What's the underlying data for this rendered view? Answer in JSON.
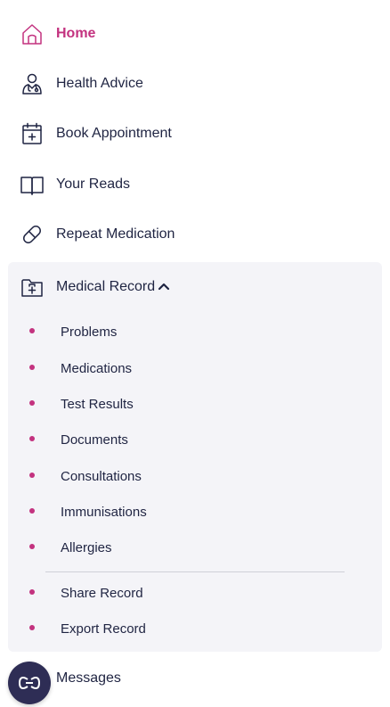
{
  "nav": {
    "items": [
      {
        "label": "Home",
        "icon": "home-icon",
        "active": true
      },
      {
        "label": "Health Advice",
        "icon": "doctor-icon"
      },
      {
        "label": "Book Appointment",
        "icon": "calendar-plus-icon"
      },
      {
        "label": "Your Reads",
        "icon": "book-icon"
      },
      {
        "label": "Repeat Medication",
        "icon": "pill-icon"
      }
    ],
    "medical_record": {
      "label": "Medical Record",
      "icon": "folder-plus-icon",
      "expanded": true,
      "sub_items": [
        {
          "label": "Problems"
        },
        {
          "label": "Medications"
        },
        {
          "label": "Test Results"
        },
        {
          "label": "Documents"
        },
        {
          "label": "Consultations"
        },
        {
          "label": "Immunisations"
        },
        {
          "label": "Allergies"
        }
      ],
      "extra_items": [
        {
          "label": "Share Record"
        },
        {
          "label": "Export Record"
        }
      ]
    },
    "messages": {
      "label": "Messages"
    }
  },
  "colors": {
    "accent": "#c3327f",
    "text": "#1f2442",
    "panel_bg": "#f4f4f8",
    "fab_bg": "#2e2d55"
  }
}
